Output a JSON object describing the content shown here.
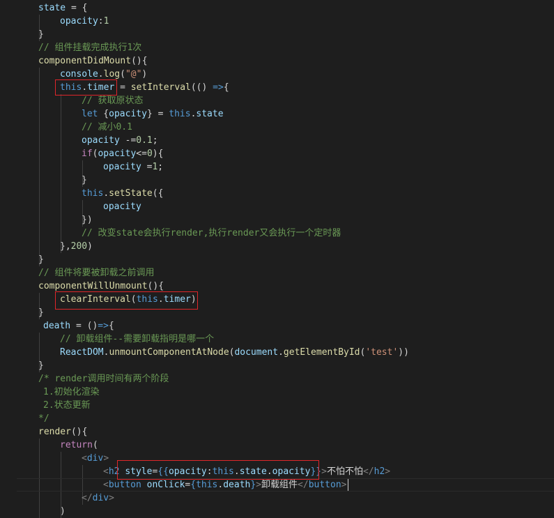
{
  "editor": {
    "language": "javascript-react",
    "colors": {
      "background": "#1e1e1e",
      "keyword": "#569cd6",
      "function": "#dcdcaa",
      "variable": "#9cdcfe",
      "string": "#ce9178",
      "number": "#b5cea8",
      "comment": "#6a9955",
      "control": "#c586c0",
      "annotation_box": "#e0262a"
    },
    "lines": [
      [
        {
          "t": "state",
          "c": "var"
        },
        {
          "t": " = {",
          "c": "txt"
        }
      ],
      [
        {
          "t": "opacity",
          "c": "var"
        },
        {
          "t": ":",
          "c": "txt"
        },
        {
          "t": "1",
          "c": "num"
        }
      ],
      [
        {
          "t": "}",
          "c": "txt"
        }
      ],
      [
        {
          "t": "// 组件挂载完成执行1次",
          "c": "cmt"
        }
      ],
      [
        {
          "t": "componentDidMount",
          "c": "fn"
        },
        {
          "t": "(){",
          "c": "txt"
        }
      ],
      [
        {
          "t": "console",
          "c": "var"
        },
        {
          "t": ".",
          "c": "txt"
        },
        {
          "t": "log",
          "c": "fn"
        },
        {
          "t": "(",
          "c": "txt"
        },
        {
          "t": "\"@\"",
          "c": "str"
        },
        {
          "t": ")",
          "c": "txt"
        }
      ],
      [
        {
          "t": "this",
          "c": "kw"
        },
        {
          "t": ".",
          "c": "txt"
        },
        {
          "t": "timer",
          "c": "var"
        },
        {
          "t": " = ",
          "c": "txt"
        },
        {
          "t": "setInterval",
          "c": "fn"
        },
        {
          "t": "(() ",
          "c": "txt"
        },
        {
          "t": "=>",
          "c": "kw"
        },
        {
          "t": "{",
          "c": "txt"
        }
      ],
      [
        {
          "t": "// 获取原状态",
          "c": "cmt"
        }
      ],
      [
        {
          "t": "let",
          "c": "kw"
        },
        {
          "t": " {",
          "c": "txt"
        },
        {
          "t": "opacity",
          "c": "var"
        },
        {
          "t": "} = ",
          "c": "txt"
        },
        {
          "t": "this",
          "c": "kw"
        },
        {
          "t": ".",
          "c": "txt"
        },
        {
          "t": "state",
          "c": "var"
        }
      ],
      [
        {
          "t": "// 减小0.1",
          "c": "cmt"
        }
      ],
      [
        {
          "t": "opacity",
          "c": "var"
        },
        {
          "t": " -=",
          "c": "txt"
        },
        {
          "t": "0.1",
          "c": "num"
        },
        {
          "t": ";",
          "c": "txt"
        }
      ],
      [
        {
          "t": "if",
          "c": "ctl"
        },
        {
          "t": "(",
          "c": "txt"
        },
        {
          "t": "opacity",
          "c": "var"
        },
        {
          "t": "<=",
          "c": "txt"
        },
        {
          "t": "0",
          "c": "num"
        },
        {
          "t": "){",
          "c": "txt"
        }
      ],
      [
        {
          "t": "opacity",
          "c": "var"
        },
        {
          "t": " =",
          "c": "txt"
        },
        {
          "t": "1",
          "c": "num"
        },
        {
          "t": ";",
          "c": "txt"
        }
      ],
      [
        {
          "t": "}",
          "c": "txt"
        }
      ],
      [
        {
          "t": "this",
          "c": "kw"
        },
        {
          "t": ".",
          "c": "txt"
        },
        {
          "t": "setState",
          "c": "fn"
        },
        {
          "t": "({",
          "c": "txt"
        }
      ],
      [
        {
          "t": "opacity",
          "c": "var"
        }
      ],
      [
        {
          "t": "})",
          "c": "txt"
        }
      ],
      [
        {
          "t": "// 改变state会执行render,执行render又会执行一个定时器",
          "c": "cmt"
        }
      ],
      [
        {
          "t": "},",
          "c": "txt"
        },
        {
          "t": "200",
          "c": "num"
        },
        {
          "t": ")",
          "c": "txt"
        }
      ],
      [
        {
          "t": "}",
          "c": "txt"
        }
      ],
      [
        {
          "t": "// 组件将要被卸载之前调用",
          "c": "cmt"
        }
      ],
      [
        {
          "t": "componentWillUnmount",
          "c": "fn"
        },
        {
          "t": "(){",
          "c": "txt"
        }
      ],
      [
        {
          "t": "clearInterval",
          "c": "fn"
        },
        {
          "t": "(",
          "c": "txt"
        },
        {
          "t": "this",
          "c": "kw"
        },
        {
          "t": ".",
          "c": "txt"
        },
        {
          "t": "timer",
          "c": "var"
        },
        {
          "t": ")",
          "c": "txt"
        }
      ],
      [
        {
          "t": "}",
          "c": "txt"
        }
      ],
      [
        {
          "t": "death",
          "c": "var"
        },
        {
          "t": " = ()",
          "c": "txt"
        },
        {
          "t": "=>",
          "c": "kw"
        },
        {
          "t": "{",
          "c": "txt"
        }
      ],
      [
        {
          "t": "// 卸载组件--需要卸载指明是哪一个",
          "c": "cmt"
        }
      ],
      [
        {
          "t": "ReactDOM",
          "c": "var"
        },
        {
          "t": ".",
          "c": "txt"
        },
        {
          "t": "unmountComponentAtNode",
          "c": "fn"
        },
        {
          "t": "(",
          "c": "txt"
        },
        {
          "t": "document",
          "c": "var"
        },
        {
          "t": ".",
          "c": "txt"
        },
        {
          "t": "getElementById",
          "c": "fn"
        },
        {
          "t": "(",
          "c": "txt"
        },
        {
          "t": "'test'",
          "c": "str"
        },
        {
          "t": "))",
          "c": "txt"
        }
      ],
      [
        {
          "t": "}",
          "c": "txt"
        }
      ],
      [
        {
          "t": "/* render调用时间有两个阶段",
          "c": "cmt"
        }
      ],
      [
        {
          "t": "1.初始化渲染",
          "c": "cmt"
        }
      ],
      [
        {
          "t": "2.状态更新",
          "c": "cmt"
        }
      ],
      [
        {
          "t": "*/",
          "c": "cmt"
        }
      ],
      [
        {
          "t": "render",
          "c": "fn"
        },
        {
          "t": "(){",
          "c": "txt"
        }
      ],
      [
        {
          "t": "return",
          "c": "ctl"
        },
        {
          "t": "(",
          "c": "txt"
        }
      ],
      [
        {
          "t": "<",
          "c": "brk"
        },
        {
          "t": "div",
          "c": "tag"
        },
        {
          "t": ">",
          "c": "brk"
        }
      ],
      [
        {
          "t": "<",
          "c": "brk"
        },
        {
          "t": "h2",
          "c": "tag"
        },
        {
          "t": " ",
          "c": "txt"
        },
        {
          "t": "style",
          "c": "attr"
        },
        {
          "t": "=",
          "c": "txt"
        },
        {
          "t": "{{",
          "c": "kw"
        },
        {
          "t": "opacity",
          "c": "var"
        },
        {
          "t": ":",
          "c": "txt"
        },
        {
          "t": "this",
          "c": "kw"
        },
        {
          "t": ".",
          "c": "txt"
        },
        {
          "t": "state",
          "c": "var"
        },
        {
          "t": ".",
          "c": "txt"
        },
        {
          "t": "opacity",
          "c": "var"
        },
        {
          "t": "}}",
          "c": "kw"
        },
        {
          "t": ">",
          "c": "brk"
        },
        {
          "t": "不怕不怕",
          "c": "txt"
        },
        {
          "t": "</",
          "c": "brk"
        },
        {
          "t": "h2",
          "c": "tag"
        },
        {
          "t": ">",
          "c": "brk"
        }
      ],
      [
        {
          "t": "<",
          "c": "brk"
        },
        {
          "t": "button",
          "c": "tag"
        },
        {
          "t": " ",
          "c": "txt"
        },
        {
          "t": "onClick",
          "c": "attr"
        },
        {
          "t": "=",
          "c": "txt"
        },
        {
          "t": "{",
          "c": "kw"
        },
        {
          "t": "this",
          "c": "kw"
        },
        {
          "t": ".",
          "c": "txt"
        },
        {
          "t": "death",
          "c": "var"
        },
        {
          "t": "}",
          "c": "kw"
        },
        {
          "t": ">",
          "c": "brk"
        },
        {
          "t": "卸载组件",
          "c": "txt"
        },
        {
          "t": "</",
          "c": "brk"
        },
        {
          "t": "button",
          "c": "tag"
        },
        {
          "t": ">",
          "c": "brk"
        }
      ],
      [
        {
          "t": "</",
          "c": "brk"
        },
        {
          "t": "div",
          "c": "tag"
        },
        {
          "t": ">",
          "c": "brk"
        }
      ],
      [
        {
          "t": ")",
          "c": "txt"
        }
      ]
    ]
  }
}
